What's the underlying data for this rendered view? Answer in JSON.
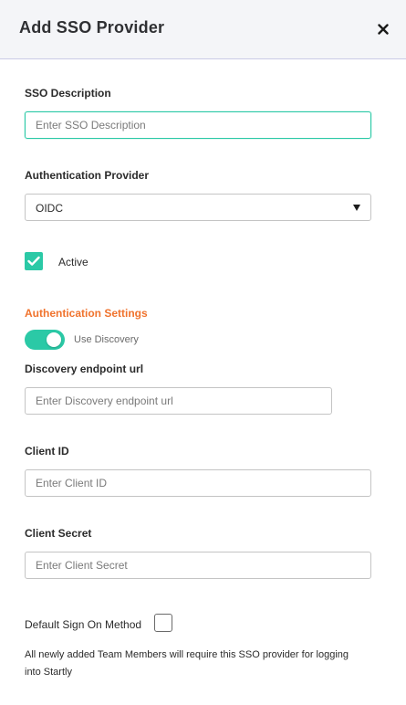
{
  "header": {
    "title": "Add SSO Provider",
    "close_icon": "close-icon"
  },
  "sso_description": {
    "label": "SSO Description",
    "placeholder": "Enter SSO Description",
    "value": ""
  },
  "authentication_provider": {
    "label": "Authentication Provider",
    "selected": "OIDC"
  },
  "active": {
    "label": "Active",
    "checked": true
  },
  "authentication_settings": {
    "title": "Authentication Settings",
    "use_discovery_label": "Use Discovery",
    "use_discovery_enabled": true
  },
  "discovery_endpoint": {
    "label": "Discovery endpoint url",
    "placeholder": "Enter Discovery endpoint url",
    "value": ""
  },
  "client_id": {
    "label": "Client ID",
    "placeholder": "Enter Client ID",
    "value": ""
  },
  "client_secret": {
    "label": "Client Secret",
    "placeholder": "Enter Client Secret",
    "value": ""
  },
  "default_sign_on": {
    "label": "Default Sign On Method",
    "checked": false,
    "note": "All newly added Team Members will require this SSO provider for logging into Startly"
  },
  "colors": {
    "accent": "#2bc9a6",
    "section_title": "#f0732d",
    "header_bg": "#f4f5f8"
  }
}
